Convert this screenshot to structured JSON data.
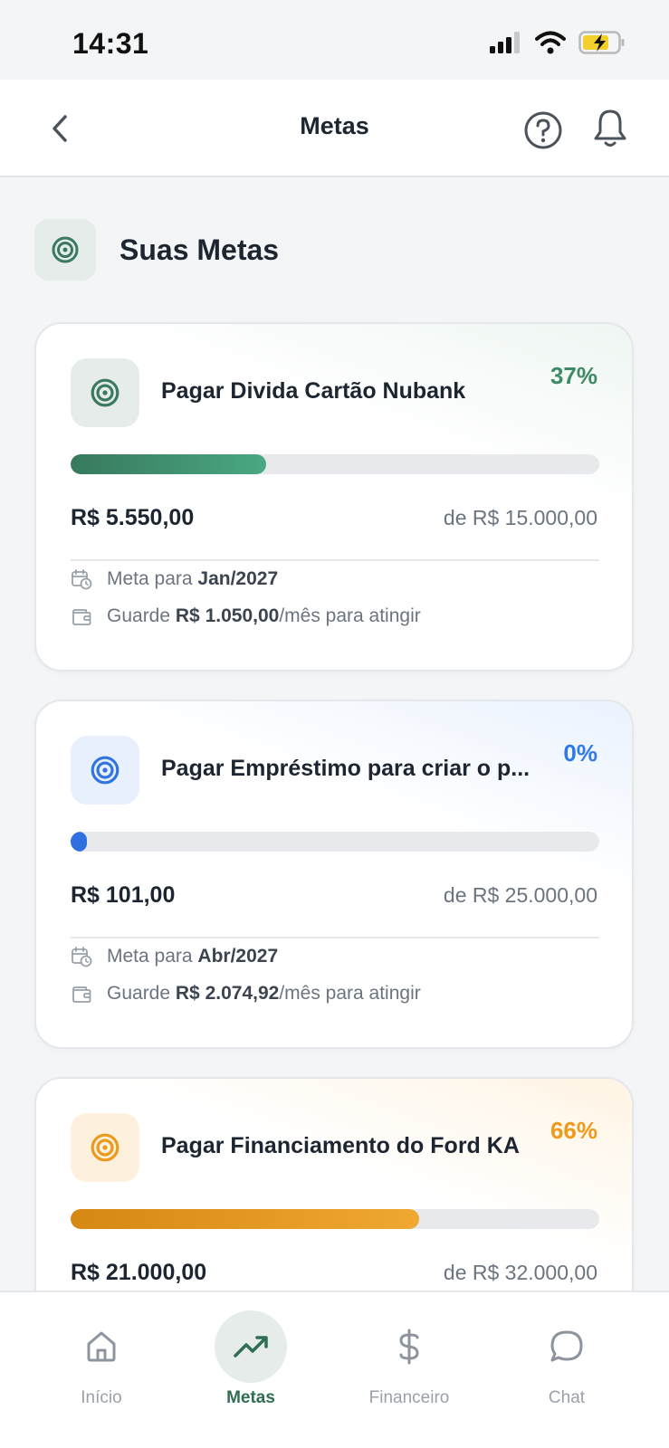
{
  "status_bar": {
    "time": "14:31"
  },
  "header": {
    "title": "Metas"
  },
  "section": {
    "title": "Suas Metas"
  },
  "colors": {
    "green": "#3f8a66",
    "blue": "#2f7ae5",
    "orange": "#ee9a1a"
  },
  "goals": [
    {
      "title": "Pagar Divida Cartão Nubank",
      "percent_label": "37%",
      "progress": 0.37,
      "current": "R$ 5.550,00",
      "target": "de R$ 15.000,00",
      "deadline_prefix": "Meta para ",
      "deadline": "Jan/2027",
      "save_prefix": "Guarde ",
      "save_amount": "R$ 1.050,00",
      "save_suffix": "/mês para atingir"
    },
    {
      "title": "Pagar Empréstimo para criar o p...",
      "percent_label": "0%",
      "progress": 0.0,
      "current": "R$ 101,00",
      "target": "de R$ 25.000,00",
      "deadline_prefix": "Meta para ",
      "deadline": "Abr/2027",
      "save_prefix": "Guarde ",
      "save_amount": "R$ 2.074,92",
      "save_suffix": "/mês para atingir"
    },
    {
      "title": "Pagar Financiamento do Ford KA",
      "percent_label": "66%",
      "progress": 0.66,
      "current": "R$ 21.000,00",
      "target": "de R$ 32.000,00"
    }
  ],
  "nav": {
    "items": [
      {
        "label": "Início",
        "icon": "home-icon"
      },
      {
        "label": "Metas",
        "icon": "trending-up-icon"
      },
      {
        "label": "Financeiro",
        "icon": "dollar-icon"
      },
      {
        "label": "Chat",
        "icon": "chat-bubble-icon"
      }
    ]
  }
}
